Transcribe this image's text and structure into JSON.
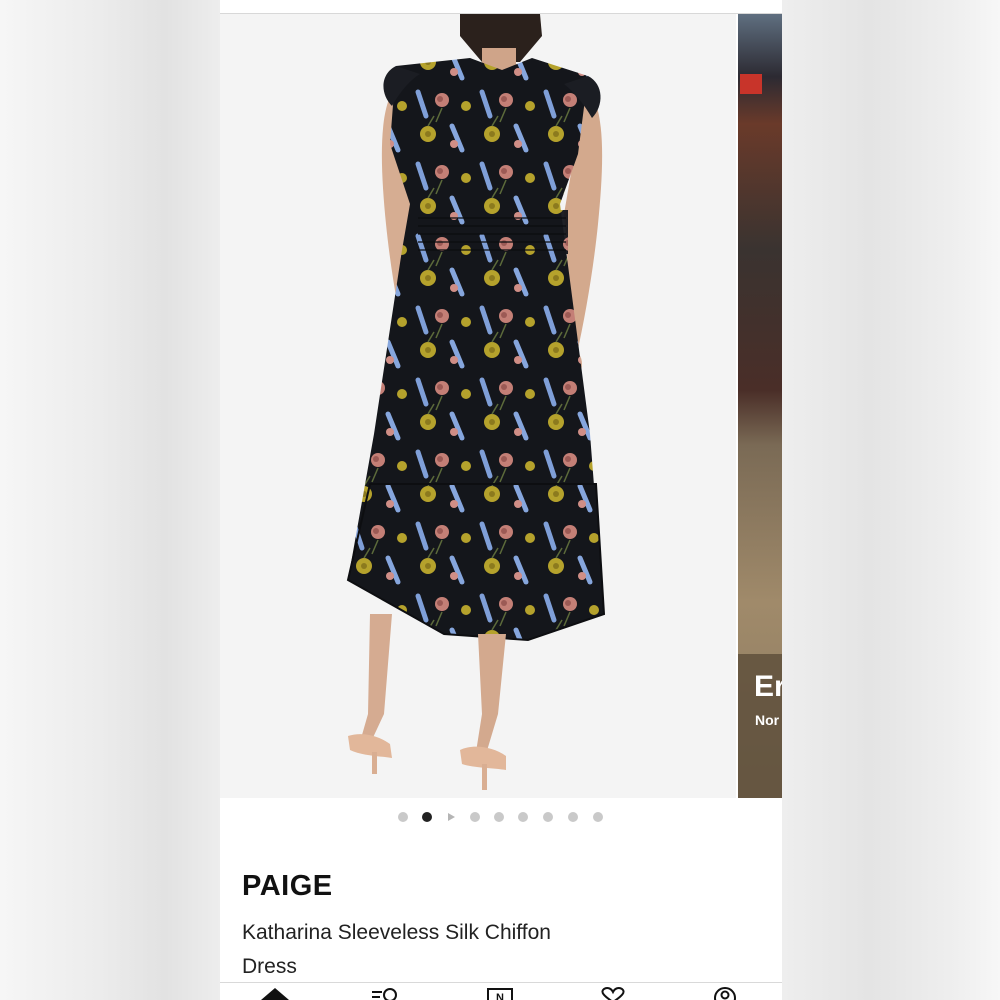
{
  "product": {
    "brand": "PAIGE",
    "name": "Katharina Sleeveless Silk Chiffon Dress"
  },
  "gallery": {
    "main_image": "woman-in-black-floral-midi-dress-back-view",
    "next_card": {
      "title": "Er",
      "subtitle": "Nor"
    },
    "dots": {
      "total": 9,
      "active_index": 1,
      "video_index": 2
    }
  },
  "bottom_nav": {
    "items": [
      "home-icon",
      "browse-icon",
      "nordstrom-n-icon",
      "heart-icon",
      "account-icon"
    ]
  },
  "colors": {
    "dress_base": "#15171c",
    "flower_yellow": "#b9a42e",
    "flower_pink": "#c9847a",
    "flower_blue": "#8aa7dc",
    "accent_text": "#111111"
  }
}
